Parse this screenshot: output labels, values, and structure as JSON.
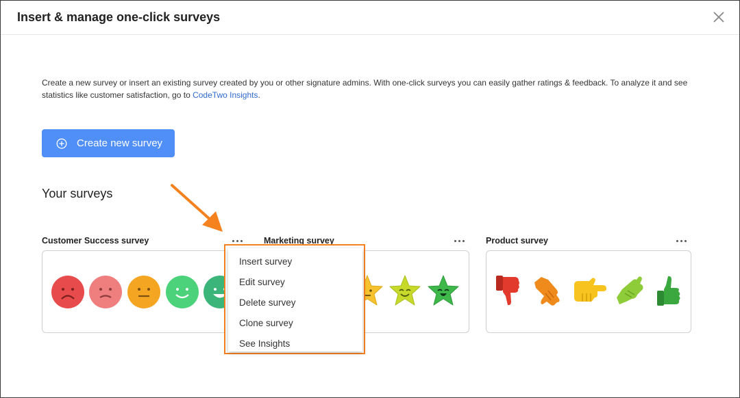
{
  "dialog": {
    "title": "Insert & manage one-click surveys",
    "close_icon": "close-icon"
  },
  "intro": {
    "text": "Create a new survey or insert an existing survey created by you or other signature admins. With one-click surveys you can easily gather ratings & feedback. To analyze it and see statistics like customer satisfaction, go to ",
    "link_text": "CodeTwo Insights",
    "suffix": "."
  },
  "create_button": {
    "label": "Create new survey",
    "icon": "plus-circle-icon",
    "color": "#4f8ff7"
  },
  "surveys_heading": "Your surveys",
  "surveys": [
    {
      "title": "Customer Success survey",
      "style": "faces",
      "colors": [
        "#e84b4b",
        "#ef7f7f",
        "#f4a623",
        "#4cd27a",
        "#3bb57a"
      ]
    },
    {
      "title": "Marketing survey",
      "style": "stars",
      "colors": [
        "#f6c22f",
        "#c7d92a",
        "#3eb84a"
      ]
    },
    {
      "title": "Product survey",
      "style": "thumbs",
      "colors": [
        "#e23b2e",
        "#ef8a1d",
        "#f7c31f",
        "#8fcc3a",
        "#3aa83f"
      ]
    }
  ],
  "context_menu": {
    "items": [
      "Insert survey",
      "Edit survey",
      "Delete survey",
      "Clone survey",
      "See Insights"
    ],
    "highlight_color": "#f5811f"
  }
}
